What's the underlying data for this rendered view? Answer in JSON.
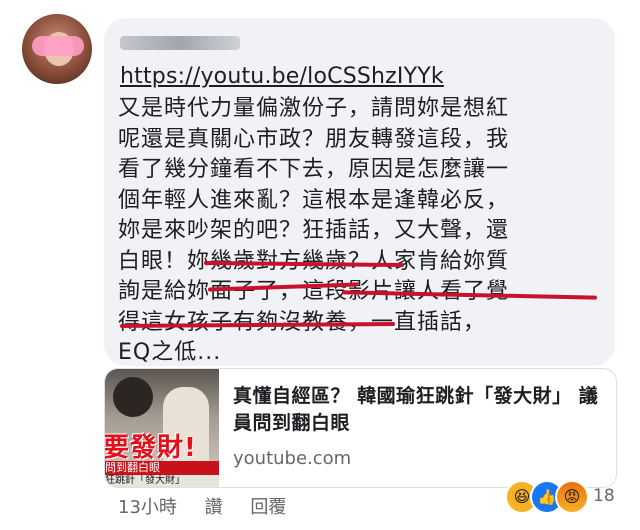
{
  "comment": {
    "link": "https://youtu.be/loCSShzIYYk",
    "lines": [
      "又是時代力量偏激份子，請問妳是想紅",
      "呢還是真關心市政？朋友轉發這段，我",
      "看了幾分鐘看不下去，原因是怎麼讓一",
      "個年輕人進來亂？這根本是逢韓必反，",
      "妳是來吵架的吧？狂插話，又大聲，還",
      "白眼！妳幾歲對方幾歲？人家肯給妳質",
      "詢是給妳面子了，這段影片讓人看了覺",
      "得這女孩子有夠沒教養，一直插話，",
      "EQ之低..."
    ]
  },
  "preview": {
    "title": "真懂自經區？ 韓國瑜狂跳針「發大財」 議員問到翻白眼",
    "domain": "youtube.com",
    "thumbnail": {
      "big_text": "要發財!",
      "caption1": "問到翻白眼",
      "caption2": "狂跳針「發大財」"
    }
  },
  "actions": {
    "time": "13小時",
    "like": "讚",
    "reply": "回覆"
  },
  "reactions": {
    "icons": [
      "haha-icon",
      "like-icon",
      "angry-icon"
    ],
    "count": "18"
  },
  "colors": {
    "bubble": "#f0f2f5",
    "underline": "#c8112a",
    "muted": "#65676b"
  }
}
